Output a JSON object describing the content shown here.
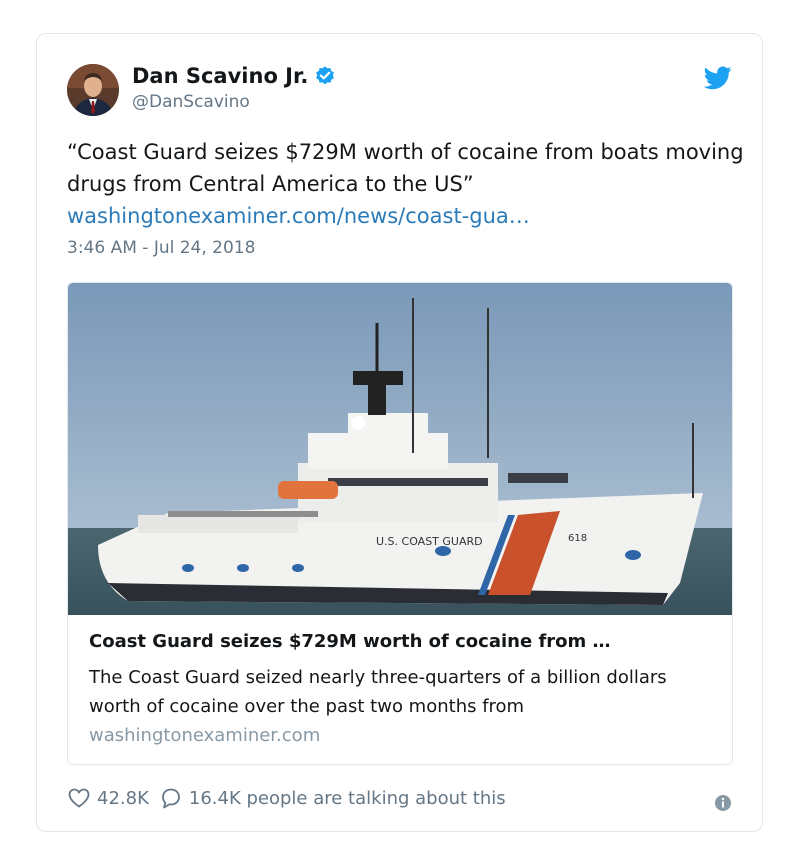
{
  "author": {
    "name": "Dan Scavino Jr.",
    "handle": "@DanScavino",
    "verified": true,
    "avatar_icon": "profile-photo"
  },
  "tweet": {
    "text": "“Coast Guard seizes $729M worth of cocaine from boats moving drugs from Central America to the US”",
    "link": "washingtonexaminer.com/news/coast-gua…",
    "timestamp": "3:46 AM - Jul 24, 2018"
  },
  "card": {
    "image_icon": "coast-guard-cutter-photo",
    "hull_text": "U.S. COAST GUARD",
    "hull_number": "618",
    "title": "Coast Guard seizes $729M worth of cocaine from …",
    "description": "The Coast Guard seized nearly three-quarters of a billion dollars worth of cocaine over the past two months from",
    "domain": "washingtonexaminer.com"
  },
  "actions": {
    "likes": "42.8K",
    "talking": "16.4K people are talking about this"
  },
  "colors": {
    "brand_blue": "#1da1f2",
    "link_blue": "#2b7bb9",
    "secondary_text": "#657786",
    "border": "#e1e8ed"
  }
}
